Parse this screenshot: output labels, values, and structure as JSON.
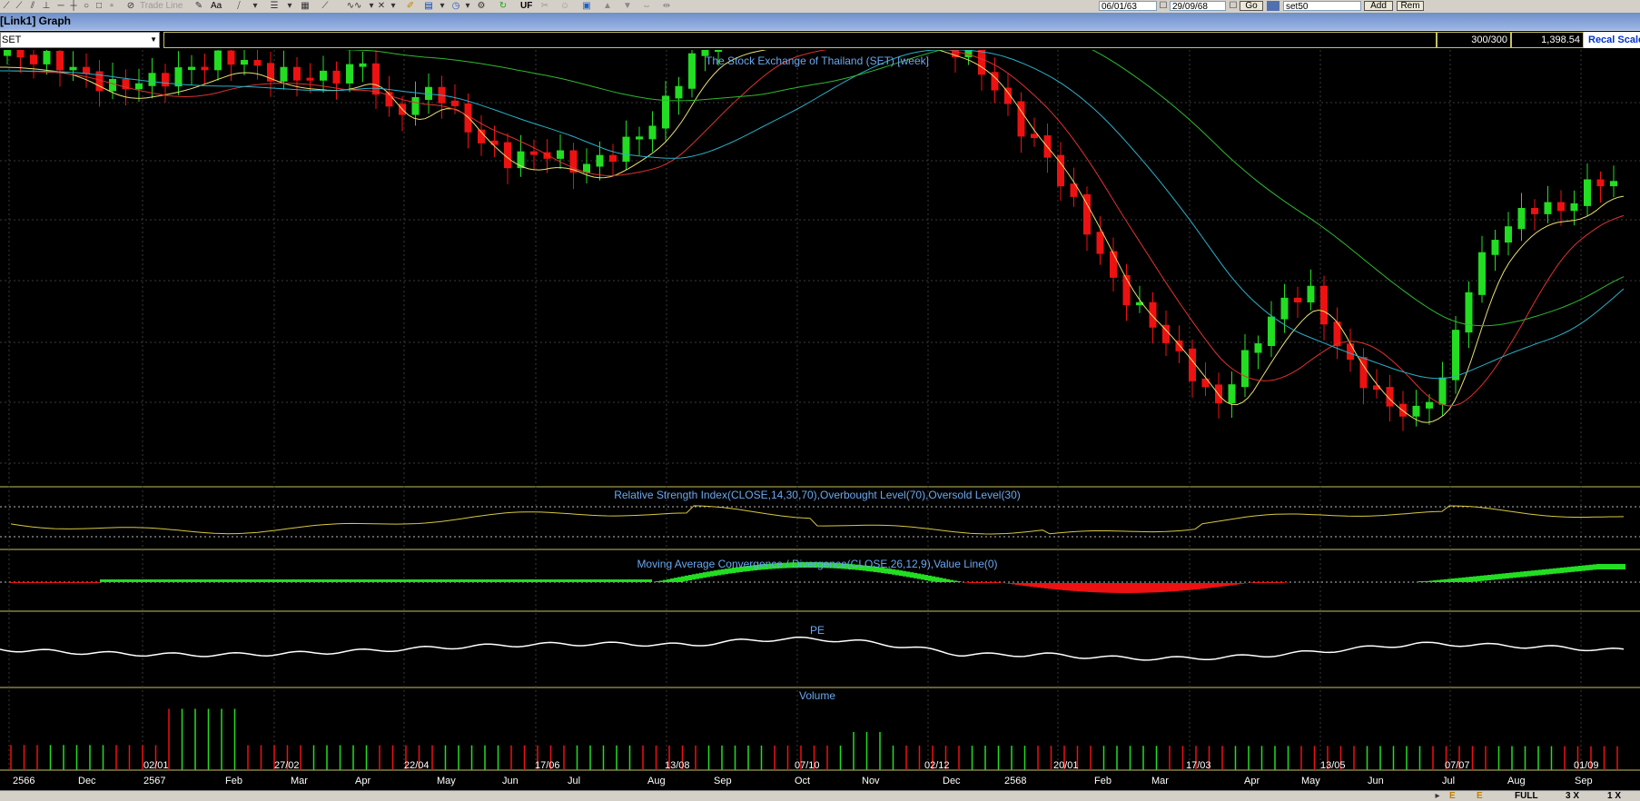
{
  "toolbar": {
    "trade_line_label": "Trade Line",
    "aa_label": "Aa",
    "uf_label": "UF",
    "date_from": "06/01/63",
    "date_to": "29/09/68",
    "go_label": "Go",
    "set_field": "set50",
    "add_label": "Add",
    "remove_label": "Rem"
  },
  "window": {
    "title": "[Link1] Graph"
  },
  "symbol": {
    "value": "SET"
  },
  "info": {
    "bars": "300/300",
    "last": "1,398.54",
    "recal_label": "Recal Scale"
  },
  "bottom": {
    "full_label": "FULL",
    "zoom_3x": "3 X",
    "zoom_1x": "1 X"
  },
  "colors": {
    "up": "#22dd22",
    "down": "#ee1111",
    "ma_fast": "#e8e070",
    "ma_mid": "#e03030",
    "ma_slow_cyan": "#2ab0c8",
    "ma_slow_green": "#30b830",
    "panel_border": "#c8c060",
    "title_blue": "#6aa8f0",
    "grid": "#3a3a3a"
  },
  "chart_data": [
    {
      "type": "candlestick",
      "title": "The Stock Exchange of Thailand (SET) [week]",
      "x_labels": [
        "2566",
        "Dec",
        "02/01",
        "2567",
        "Feb",
        "27/02",
        "Mar",
        "Apr",
        "22/04",
        "May",
        "Jun",
        "17/06",
        "Jul",
        "Aug",
        "13/08",
        "Sep",
        "07/10",
        "Oct",
        "Nov",
        "02/12",
        "Dec",
        "2568",
        "20/01",
        "Feb",
        "Mar",
        "17/03",
        "Apr",
        "May",
        "13/05",
        "Jun",
        "Jul",
        "07/07",
        "Aug",
        "01/09",
        "Sep"
      ]
    },
    {
      "type": "line",
      "title": "Relative Strength Index(CLOSE,14,30,70),Overbought Level(70),Oversold Level(30)"
    },
    {
      "type": "area",
      "title": "Moving Average Convergence / Divergence(CLOSE,26,12,9),Value Line(0)"
    },
    {
      "type": "line",
      "title": "PE"
    },
    {
      "type": "bar",
      "title": "Volume"
    }
  ]
}
